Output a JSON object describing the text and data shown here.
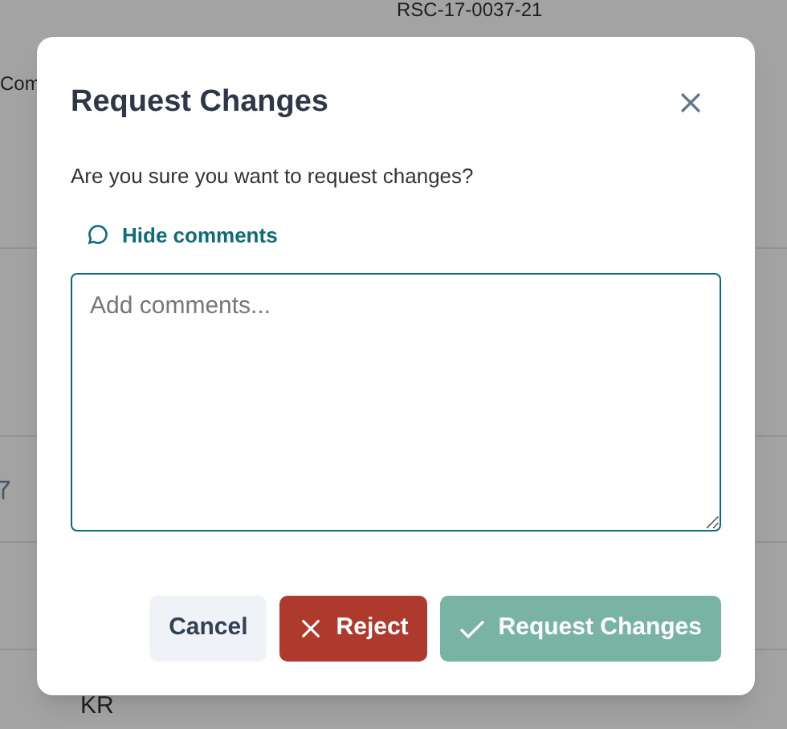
{
  "background": {
    "reference": "RSC-17-0037-21",
    "column_label": "Com",
    "initials": "KR"
  },
  "dialog": {
    "title": "Request Changes",
    "message": "Are you sure you want to request changes?",
    "toggle_comments": "Hide comments",
    "comments": {
      "placeholder": "Add comments..."
    },
    "buttons": [
      {
        "kind": "secondary",
        "label": "Cancel",
        "disabled": false
      },
      {
        "kind": "danger",
        "label": "Reject",
        "disabled": false
      },
      {
        "kind": "primary",
        "label": "Request Changes",
        "disabled": true
      }
    ]
  }
}
